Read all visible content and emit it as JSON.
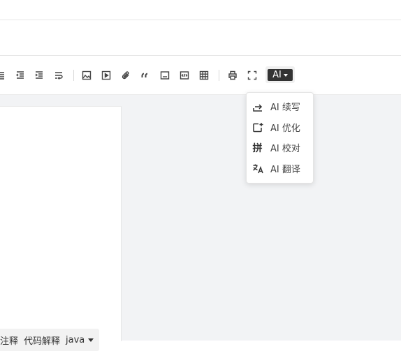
{
  "toolbar": {
    "icons": [
      "align-justify-icon",
      "outdent-icon",
      "indent-icon",
      "line-break-icon",
      "image-icon",
      "video-icon",
      "attachment-icon",
      "quote-icon",
      "code-line-icon",
      "code-block-icon",
      "table-icon",
      "print-icon",
      "fullscreen-icon"
    ],
    "ai_label": "AI"
  },
  "ai_menu": {
    "items": [
      {
        "label": "AI 续写",
        "icon": "continue-write-icon"
      },
      {
        "label": "AI 优化",
        "icon": "optimize-icon"
      },
      {
        "label": "AI 校对",
        "icon": "proofread-icon",
        "glyph": "拼"
      },
      {
        "label": "AI 翻译",
        "icon": "translate-icon"
      }
    ]
  },
  "code_toolbar": {
    "comment_label": "注释",
    "explain_label": "代码解释",
    "language": "java"
  }
}
